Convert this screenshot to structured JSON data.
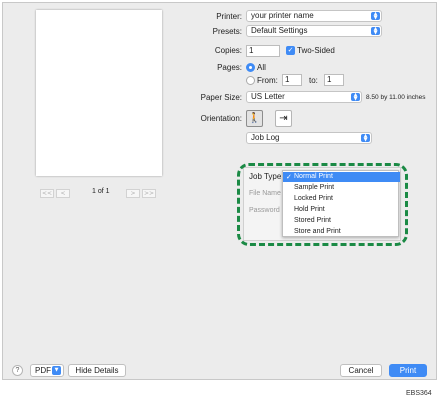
{
  "printer": {
    "label": "Printer:",
    "value": "your printer name"
  },
  "presets": {
    "label": "Presets:",
    "value": "Default Settings"
  },
  "copies": {
    "label": "Copies:",
    "value": "1",
    "two_sided_label": "Two-Sided"
  },
  "pages": {
    "label": "Pages:",
    "all_label": "All",
    "from_label": "From:",
    "from_value": "1",
    "to_label": "to:",
    "to_value": "1"
  },
  "paper_size": {
    "label": "Paper Size:",
    "value": "US Letter",
    "dimensions": "8.50 by 11.00 inches"
  },
  "orientation": {
    "label": "Orientation:",
    "portrait_icon": "portrait-person-icon",
    "landscape_icon": "landscape-person-icon"
  },
  "section_popup": {
    "value": "Job Log"
  },
  "preview": {
    "page_label": "1 of 1",
    "nav": {
      "first": "<<",
      "prev": "<",
      "next": ">",
      "last": ">>"
    }
  },
  "job_panel": {
    "job_type_label": "Job Type:",
    "file_name_label": "File Name",
    "password_label": "Password"
  },
  "job_type_menu": {
    "check_mark": "✓",
    "options": [
      "Normal Print",
      "Sample Print",
      "Locked Print",
      "Hold Print",
      "Stored Print",
      "Store and Print"
    ],
    "selected": "Normal Print"
  },
  "footer": {
    "help_label": "?",
    "pdf_label": "PDF",
    "hide_details_label": "Hide Details",
    "cancel_label": "Cancel",
    "print_label": "Print"
  },
  "figure_code": "EBS364",
  "colors": {
    "accent": "#3f8bf5",
    "highlight_border": "#1b8a45"
  }
}
